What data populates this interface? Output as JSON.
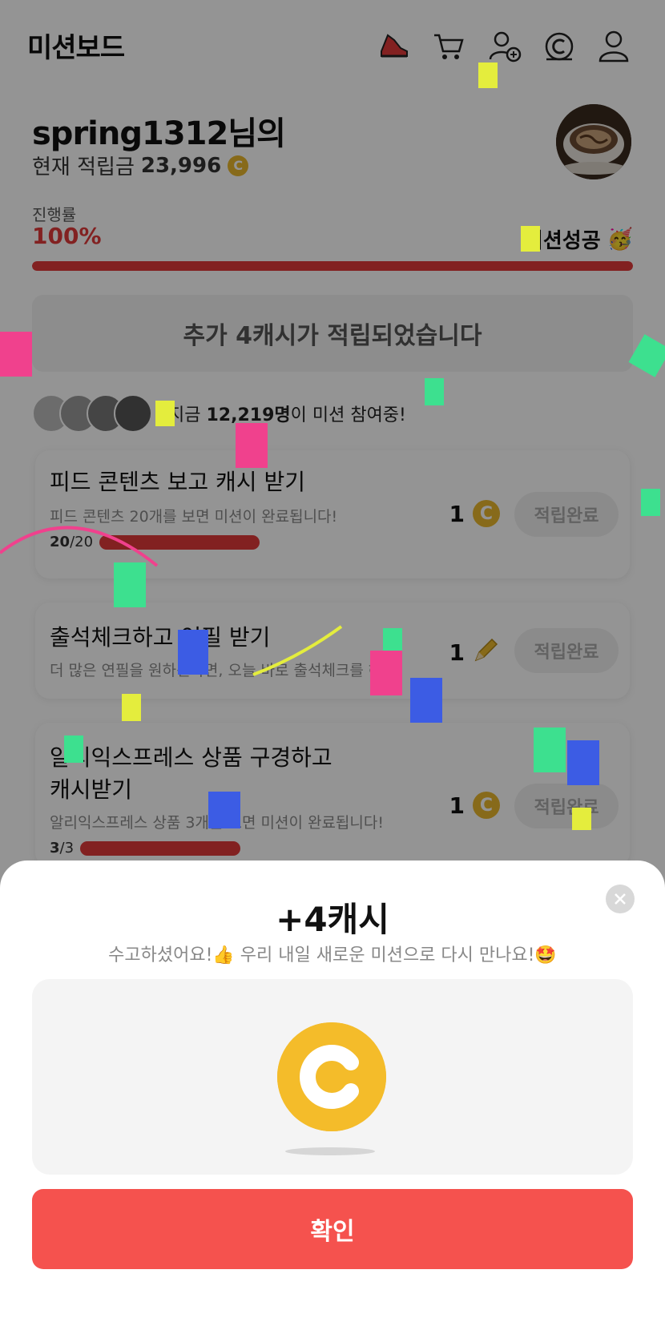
{
  "header": {
    "title": "미션보드",
    "icons": [
      "sneaker-icon",
      "cart-icon",
      "add-friend-icon",
      "cash-coin-icon",
      "profile-icon"
    ]
  },
  "user": {
    "greeting": "spring1312님의",
    "balance_label": "현재 적립금",
    "balance_value": "23,996",
    "coin_symbol": "C"
  },
  "progress": {
    "label": "진행률",
    "percent_text": "100%",
    "percent_value": 100,
    "success_text": "미션성공",
    "success_emoji": "🥳"
  },
  "notice": {
    "text": "추가 4캐시가 적립되었습니다"
  },
  "participants": {
    "prefix": "지금",
    "count": "12,219명",
    "suffix": "이 미션 참여중!"
  },
  "missions": [
    {
      "title": "피드 콘텐츠 보고 캐시 받기",
      "desc": "피드 콘텐츠 20개를 보면 미션이 완료됩니다!",
      "done": "20",
      "total": "/20",
      "reward": "1",
      "reward_icon": "cash-coin-icon",
      "button": "적립완료"
    },
    {
      "title": "출석체크하고 연필 받기",
      "desc": "더 많은 연필을 원하신다면, 오늘 바로 출석체크를 해주세요!",
      "reward": "1",
      "reward_icon": "pencil-icon",
      "button": "적립완료"
    },
    {
      "title_line1": "알리익스프레스 상품 구경하고",
      "title_line2": "캐시받기",
      "desc": "알리익스프레스 상품 3개를 보면 미션이 완료됩니다!",
      "done": "3",
      "total": "/3",
      "reward": "1",
      "reward_icon": "cash-coin-icon",
      "button": "적립완료"
    }
  ],
  "sheet": {
    "title": "+4캐시",
    "subtitle": "수고하셨어요!👍 우리 내일 새로운 미션으로 다시 만나요!🤩",
    "confirm": "확인"
  },
  "colors": {
    "accent": "#f5524e",
    "progress": "#e03a3a",
    "coin": "#f3b926"
  }
}
